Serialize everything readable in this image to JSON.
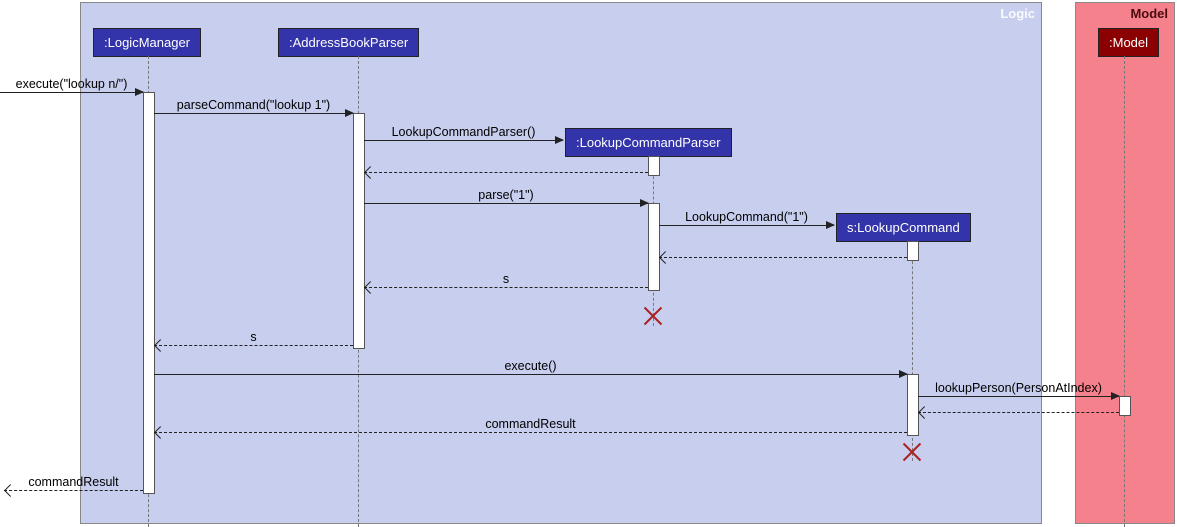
{
  "frames": {
    "logic": "Logic",
    "model": "Model"
  },
  "participants": {
    "logicManager": ":LogicManager",
    "addressBookParser": ":AddressBookParser",
    "lookupCommandParser": ":LookupCommandParser",
    "lookupCommand": "s:LookupCommand",
    "model": ":Model"
  },
  "messages": {
    "executeIn": "execute(\"lookup n/\")",
    "parseCommand": "parseCommand(\"lookup 1\")",
    "lookupCommandParserCtor": "LookupCommandParser()",
    "parse": "parse(\"1\")",
    "lookupCommandCtor": "LookupCommand(\"1\")",
    "returnS1": "s",
    "returnS2": "s",
    "execute": "execute()",
    "lookupPerson": "lookupPerson(PersonAtIndex)",
    "commandResult1": "commandResult",
    "commandResult2": "commandResult"
  },
  "chart_data": {
    "type": "sequence-diagram",
    "frames": [
      {
        "name": "Logic",
        "participants": [
          "LogicManager",
          "AddressBookParser",
          "LookupCommandParser",
          "LookupCommand"
        ]
      },
      {
        "name": "Model",
        "participants": [
          "Model"
        ]
      }
    ],
    "participants": [
      {
        "id": "LogicManager",
        "label": ":LogicManager"
      },
      {
        "id": "AddressBookParser",
        "label": ":AddressBookParser"
      },
      {
        "id": "LookupCommandParser",
        "label": ":LookupCommandParser",
        "created_by": "AddressBookParser"
      },
      {
        "id": "LookupCommand",
        "label": "s:LookupCommand",
        "created_by": "LookupCommandParser"
      },
      {
        "id": "Model",
        "label": ":Model"
      }
    ],
    "messages": [
      {
        "from": "external",
        "to": "LogicManager",
        "label": "execute(\"lookup n/\")",
        "kind": "sync"
      },
      {
        "from": "LogicManager",
        "to": "AddressBookParser",
        "label": "parseCommand(\"lookup 1\")",
        "kind": "sync"
      },
      {
        "from": "AddressBookParser",
        "to": "LookupCommandParser",
        "label": "LookupCommandParser()",
        "kind": "create"
      },
      {
        "from": "LookupCommandParser",
        "to": "AddressBookParser",
        "label": "",
        "kind": "return"
      },
      {
        "from": "AddressBookParser",
        "to": "LookupCommandParser",
        "label": "parse(\"1\")",
        "kind": "sync"
      },
      {
        "from": "LookupCommandParser",
        "to": "LookupCommand",
        "label": "LookupCommand(\"1\")",
        "kind": "create"
      },
      {
        "from": "LookupCommand",
        "to": "LookupCommandParser",
        "label": "",
        "kind": "return"
      },
      {
        "from": "LookupCommandParser",
        "to": "AddressBookParser",
        "label": "s",
        "kind": "return"
      },
      {
        "from": "LookupCommandParser",
        "to": null,
        "label": "",
        "kind": "destroy"
      },
      {
        "from": "AddressBookParser",
        "to": "LogicManager",
        "label": "s",
        "kind": "return"
      },
      {
        "from": "LogicManager",
        "to": "LookupCommand",
        "label": "execute()",
        "kind": "sync"
      },
      {
        "from": "LookupCommand",
        "to": "Model",
        "label": "lookupPerson(PersonAtIndex)",
        "kind": "sync"
      },
      {
        "from": "Model",
        "to": "LookupCommand",
        "label": "",
        "kind": "return"
      },
      {
        "from": "LookupCommand",
        "to": "LogicManager",
        "label": "commandResult",
        "kind": "return"
      },
      {
        "from": "LookupCommand",
        "to": null,
        "label": "",
        "kind": "destroy"
      },
      {
        "from": "LogicManager",
        "to": "external",
        "label": "commandResult",
        "kind": "return"
      }
    ]
  }
}
